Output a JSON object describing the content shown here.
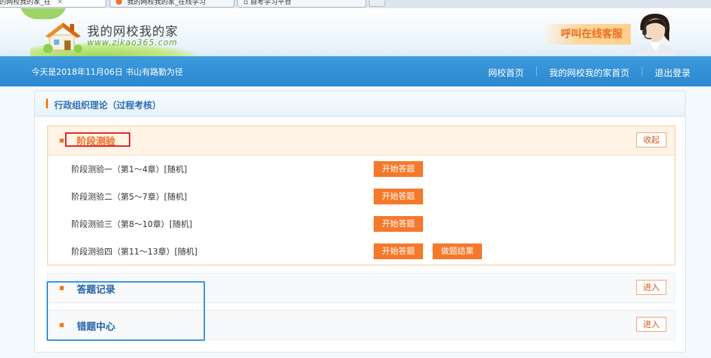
{
  "browser": {
    "tabs": [
      {
        "label": "我的网校我的家_在"
      },
      {
        "label": "我的网校我的家_在线学习"
      },
      {
        "label": "自考学习平台"
      }
    ]
  },
  "header": {
    "logo_title": "我的网校我的家",
    "logo_url": "www.zikao365.com",
    "service_label": "呼叫在线客服"
  },
  "nav": {
    "today": "今天是2018年11月06日  书山有路勤为径",
    "links": [
      "网校首页",
      "我的网校我的家首页",
      "退出登录"
    ]
  },
  "course": {
    "title": "行政组织理论（过程考核）"
  },
  "stage_section": {
    "title": "阶段测验",
    "collapse_label": "收起",
    "rows": [
      {
        "label": "阶段测验一（第1～4章）[随机]",
        "start_label": "开始答题"
      },
      {
        "label": "阶段测验二（第5～7章）[随机]",
        "start_label": "开始答题"
      },
      {
        "label": "阶段测验三（第8～10章）[随机]",
        "start_label": "开始答题"
      },
      {
        "label": "阶段测验四（第11～13章）[随机]",
        "start_label": "开始答题",
        "result_label": "做题结果"
      }
    ]
  },
  "record_section": {
    "title": "答题记录",
    "enter_label": "进入"
  },
  "wrong_section": {
    "title": "错题中心",
    "enter_label": "进入"
  },
  "colors": {
    "nav_bg": "#2b87cf",
    "accent_orange": "#f5792b",
    "section_title_blue": "#1f5fa8",
    "annotation_red": "#e3171c",
    "annotation_blue": "#2a8fe0"
  }
}
